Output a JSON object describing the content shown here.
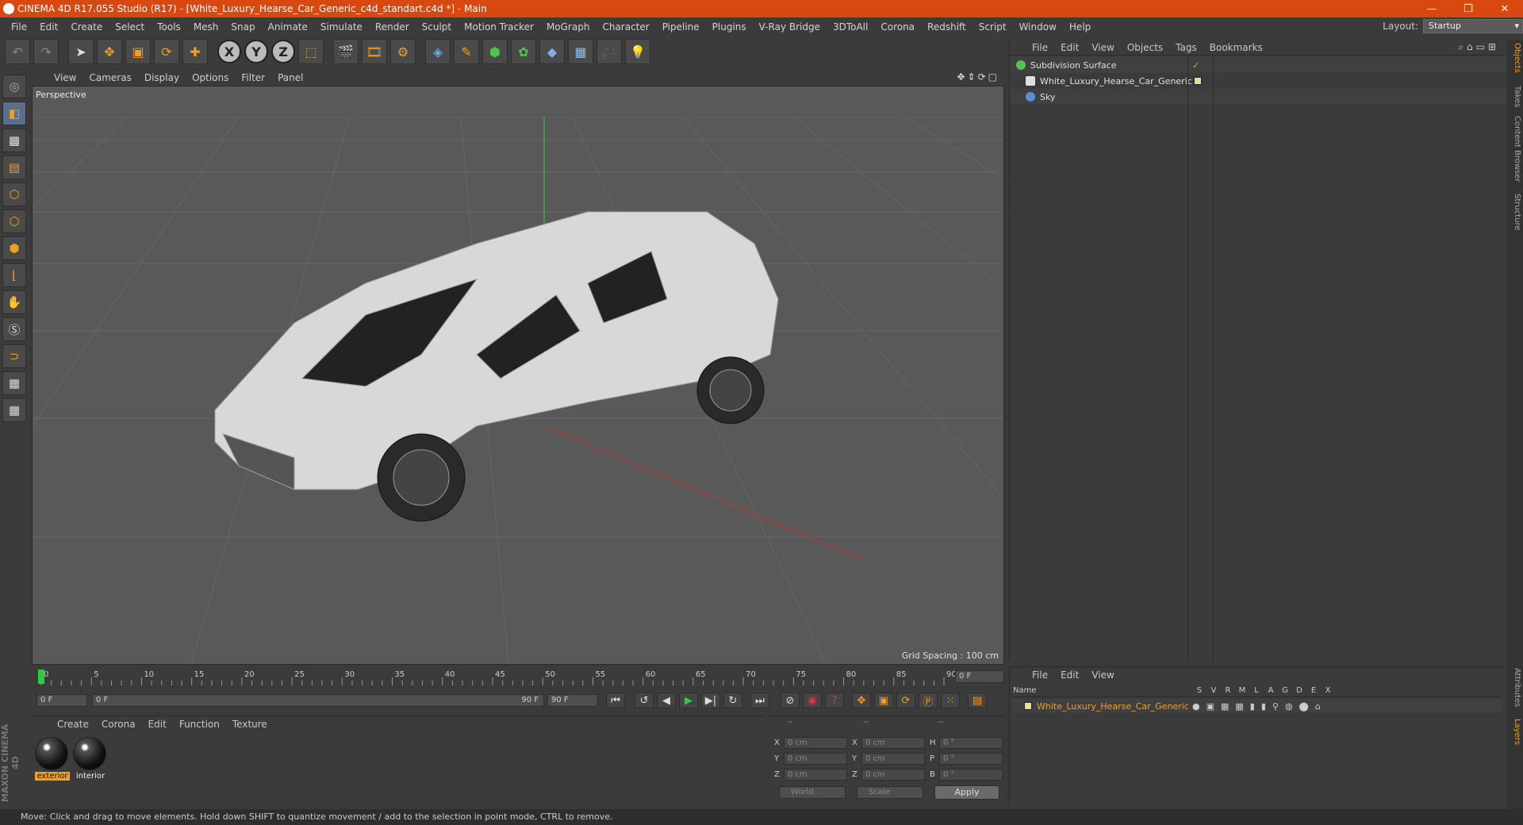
{
  "titlebar": {
    "title": "CINEMA 4D R17.055 Studio (R17) - [White_Luxury_Hearse_Car_Generic_c4d_standart.c4d *] - Main",
    "minimize": "—",
    "restore": "❐",
    "close": "✕"
  },
  "menubar": {
    "items": [
      "File",
      "Edit",
      "Create",
      "Select",
      "Tools",
      "Mesh",
      "Snap",
      "Animate",
      "Simulate",
      "Render",
      "Sculpt",
      "Motion Tracker",
      "MoGraph",
      "Character",
      "Pipeline",
      "Plugins",
      "V-Ray Bridge",
      "3DToAll",
      "Corona",
      "Redshift",
      "Script",
      "Window",
      "Help"
    ],
    "layout_label": "Layout:",
    "layout_value": "Startup"
  },
  "toolbar": {
    "icons": [
      "undo-icon",
      "redo-icon",
      "select-icon",
      "move-icon",
      "scale-icon",
      "rotate-icon",
      "add-icon",
      "x-axis-icon",
      "y-axis-icon",
      "z-axis-icon",
      "world-coord-icon",
      "render-view-icon",
      "render-picture-viewer-icon",
      "edit-render-settings-icon",
      "cube-icon",
      "pen-icon",
      "subdivision-icon",
      "array-icon",
      "deformer-icon",
      "floor-icon",
      "camera-icon",
      "light-icon"
    ],
    "x_label": "X",
    "y_label": "Y",
    "z_label": "Z"
  },
  "viewport": {
    "menu": [
      "View",
      "Cameras",
      "Display",
      "Options",
      "Filter",
      "Panel"
    ],
    "label": "Perspective",
    "grid_spacing": "Grid Spacing : 100 cm"
  },
  "timeline": {
    "ticks": [
      "0",
      "5",
      "10",
      "15",
      "20",
      "25",
      "30",
      "35",
      "40",
      "45",
      "50",
      "55",
      "60",
      "65",
      "70",
      "75",
      "80",
      "85",
      "90"
    ],
    "current_frame": "0 F",
    "start_field": "0 F",
    "range_start": "0 F",
    "range_end": "90 F",
    "end_field": "90 F"
  },
  "materials": {
    "menu": [
      "Create",
      "Corona",
      "Edit",
      "Function",
      "Texture"
    ],
    "items": [
      {
        "name": "exterior",
        "selected": true
      },
      {
        "name": "interior",
        "selected": false
      }
    ]
  },
  "coords": {
    "header": [
      "--",
      "--",
      "--"
    ],
    "rows": [
      {
        "a": "X",
        "av": "0 cm",
        "b": "X",
        "bv": "0 cm",
        "c": "H",
        "cv": "0 °"
      },
      {
        "a": "Y",
        "av": "0 cm",
        "b": "Y",
        "bv": "0 cm",
        "c": "P",
        "cv": "0 °"
      },
      {
        "a": "Z",
        "av": "0 cm",
        "b": "Z",
        "bv": "0 cm",
        "c": "B",
        "cv": "0 °"
      }
    ],
    "mode": "World",
    "scale": "Scale",
    "apply": "Apply"
  },
  "objects": {
    "menu": [
      "File",
      "Edit",
      "View",
      "Objects",
      "Tags",
      "Bookmarks"
    ],
    "rows": [
      {
        "name": "Subdivision Surface",
        "icon_color": "#4fc44f"
      },
      {
        "name": "White_Luxury_Hearse_Car_Generic",
        "icon_color": "#e0e0e0"
      },
      {
        "name": "Sky",
        "icon_color": "#5a8fd6"
      }
    ]
  },
  "layers": {
    "menu": [
      "File",
      "Edit",
      "View"
    ],
    "header": {
      "name": "Name",
      "cols": [
        "S",
        "V",
        "R",
        "M",
        "L",
        "A",
        "G",
        "D",
        "E",
        "X"
      ]
    },
    "rows": [
      {
        "name": "White_Luxury_Hearse_Car_Generic"
      }
    ]
  },
  "rightstrip": {
    "tabs": [
      "Objects",
      "Takes",
      "Content Browser",
      "Structure"
    ],
    "bottom_tabs": [
      "Attributes",
      "Layers"
    ]
  },
  "statusbar": {
    "text": "Move: Click and drag to move elements. Hold down SHIFT to quantize movement / add to the selection in point mode, CTRL to remove."
  },
  "brand": {
    "text": "MAXON CINEMA 4D"
  },
  "colors": {
    "accent": "#f0a020",
    "titlebar": "#d9480f"
  }
}
